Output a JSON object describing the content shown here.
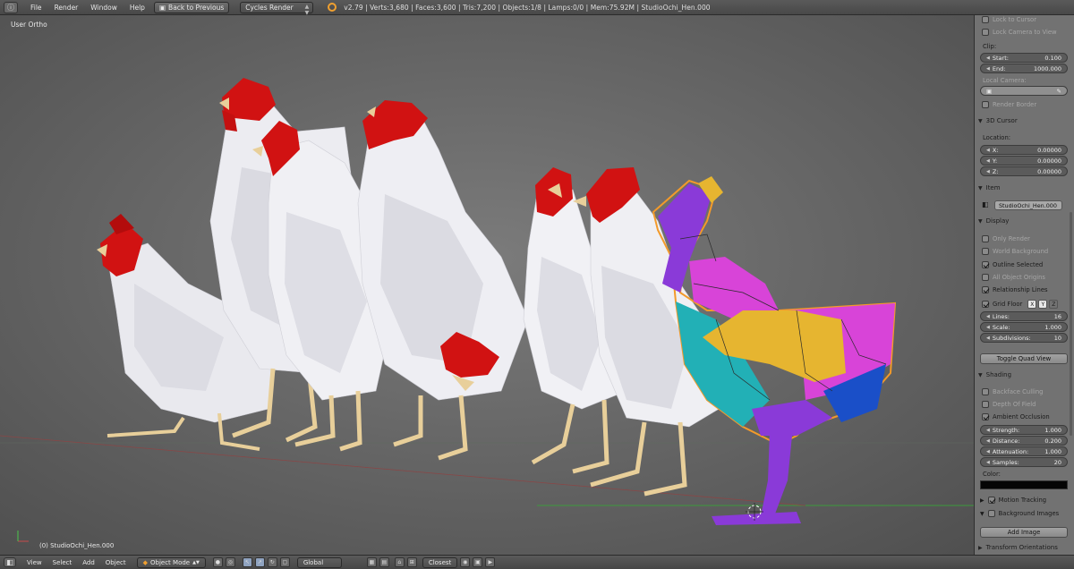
{
  "topbar": {
    "editor_icon": "info-icon",
    "menus": [
      "File",
      "Render",
      "Window",
      "Help"
    ],
    "back_button": "Back to Previous",
    "render_engine": "Cycles Render",
    "stats": "v2.79 | Verts:3,680 | Faces:3,600 | Tris:7,200 | Objects:1/8 | Lamps:0/0 | Mem:75.92M | StudioOchi_Hen.000"
  },
  "viewport": {
    "view_name": "User Ortho",
    "active_object_label": "(0) StudioOchi_Hen.000"
  },
  "props": {
    "lock_to_cursor": "Lock to Cursor",
    "lock_camera_to_view": "Lock Camera to View",
    "clip_label": "Clip:",
    "clip_start_label": "Start:",
    "clip_start_value": "0.100",
    "clip_end_label": "End:",
    "clip_end_value": "1000.000",
    "local_camera": "Local Camera:",
    "render_border": "Render Border",
    "cursor_section": "3D Cursor",
    "location_label": "Location:",
    "x_label": "X:",
    "x_value": "0.00000",
    "y_label": "Y:",
    "y_value": "0.00000",
    "z_label": "Z:",
    "z_value": "0.00000",
    "item_section": "Item",
    "item_name": "StudioOchi_Hen.000",
    "display_section": "Display",
    "only_render": "Only Render",
    "world_background": "World Background",
    "outline_selected": "Outline Selected",
    "all_object_origins": "All Object Origins",
    "relationship_lines": "Relationship Lines",
    "grid_floor": "Grid Floor",
    "axis_x": "X",
    "axis_y": "Y",
    "axis_z": "Z",
    "lines_label": "Lines:",
    "lines_value": "16",
    "scale_label": "Scale:",
    "scale_value": "1.000",
    "subdivisions_label": "Subdivisions:",
    "subdivisions_value": "10",
    "toggle_quad_view": "Toggle Quad View",
    "shading_section": "Shading",
    "backface_culling": "Backface Culling",
    "depth_of_field": "Depth Of Field",
    "ambient_occlusion": "Ambient Occlusion",
    "strength_label": "Strength:",
    "strength_value": "1.000",
    "distance_label": "Distance:",
    "distance_value": "0.200",
    "attenuation_label": "Attenuation:",
    "attenuation_value": "1.000",
    "samples_label": "Samples:",
    "samples_value": "20",
    "color_label": "Color:",
    "ao_color": "#050505",
    "motion_tracking": "Motion Tracking",
    "background_images": "Background Images",
    "add_image": "Add Image",
    "transform_orientations": "Transform Orientations"
  },
  "bottombar": {
    "menus": [
      "View",
      "Select",
      "Add",
      "Object"
    ],
    "mode": "Object Mode",
    "orientation": "Global",
    "snap_target": "Closest"
  },
  "colors": {
    "hen_white": "#e9e9ee",
    "comb_red": "#d11212",
    "beak_tan": "#e8cf9a",
    "uv_purple": "#8a3ad8",
    "uv_magenta": "#d844d8",
    "uv_teal": "#22b0b6",
    "uv_yellow": "#e6b530",
    "uv_blue": "#1a4fc8",
    "panel_bg": "#727272",
    "viewport_bg": "#3c3c3c"
  }
}
